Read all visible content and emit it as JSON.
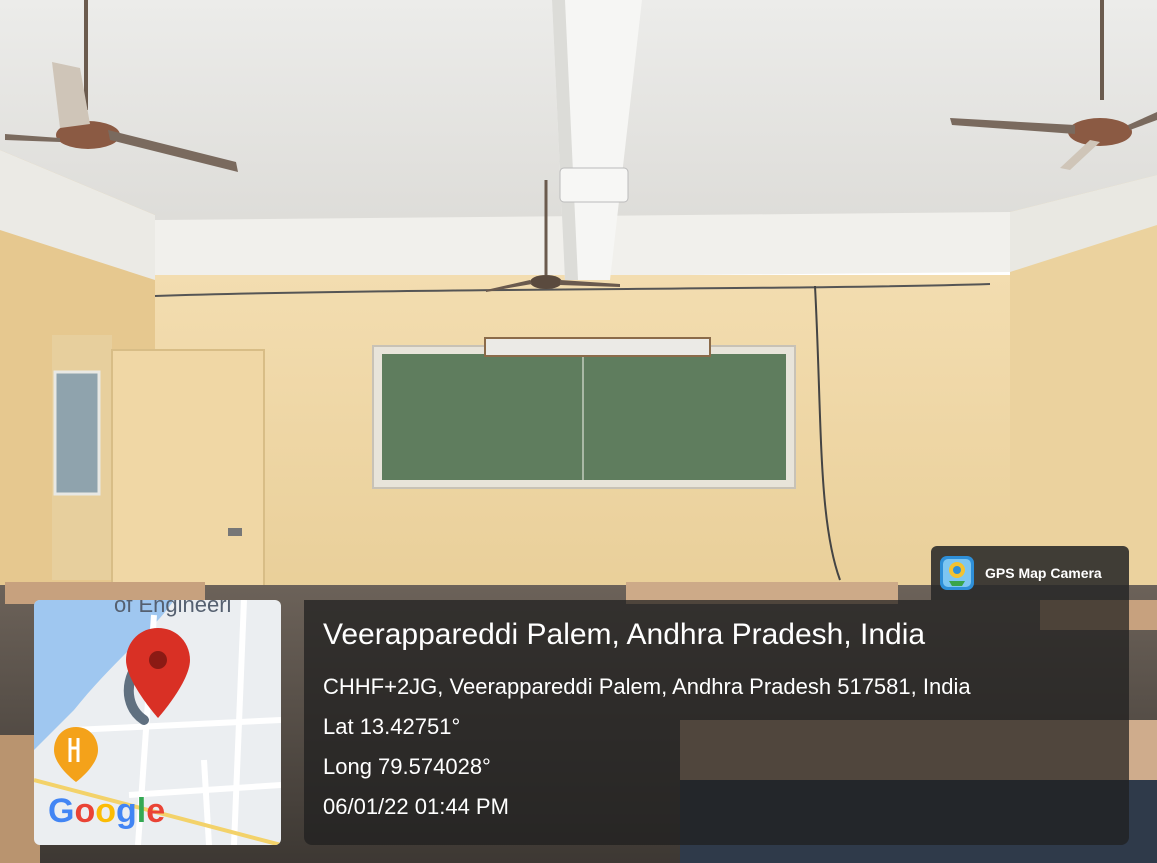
{
  "overlay": {
    "app_name": "GPS Map Camera",
    "location_title": "Veerappareddi Palem, Andhra Pradesh, India",
    "address": "CHHF+2JG, Veerappareddi Palem, Andhra Pradesh 517581, India",
    "latitude": "Lat 13.42751°",
    "longitude": "Long 79.574028°",
    "datetime": "06/01/22 01:44 PM"
  },
  "map": {
    "brand": "Google",
    "label_fragment": "of Engineeri",
    "icons": [
      "location-pin-icon",
      "restaurant-icon"
    ]
  },
  "colors": {
    "wall": "#eed7a6",
    "ceiling": "#e9e9e7",
    "chalkboard": "#5f7d5e",
    "overlay": "#1e1e1e",
    "pin": "#d93025",
    "food_pin": "#f4a21a"
  }
}
